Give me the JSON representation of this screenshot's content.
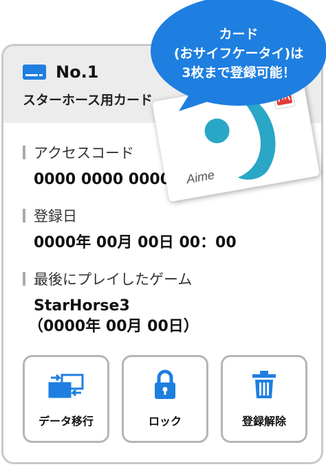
{
  "card": {
    "number": "No.1",
    "name": "スターホース用カード"
  },
  "fields": {
    "access_code_label": "アクセスコード",
    "access_code_value": "0000 0000 0000",
    "registered_label": "登録日",
    "registered_value": "0000年 00月 00日 00：00",
    "last_game_label": "最後にプレイしたゲーム",
    "last_game_title": "StarHorse3",
    "last_game_date": "（0000年 00月 00日）"
  },
  "actions": [
    {
      "label": "データ移行",
      "icon": "data-transfer-icon"
    },
    {
      "label": "ロック",
      "icon": "padlock-icon"
    },
    {
      "label": "登録解除",
      "icon": "trash-icon"
    }
  ],
  "bubble": {
    "line1": "カード",
    "line2": "(おサイフケータイ)は",
    "line3": "3枚まで登録可能！"
  },
  "aime": {
    "logo_text": "Aime"
  },
  "colors": {
    "accent": "#1e7fe0",
    "bubble": "#1e7fe0",
    "teal": "#2aa6c6",
    "brand_red": "#e43a3a"
  }
}
